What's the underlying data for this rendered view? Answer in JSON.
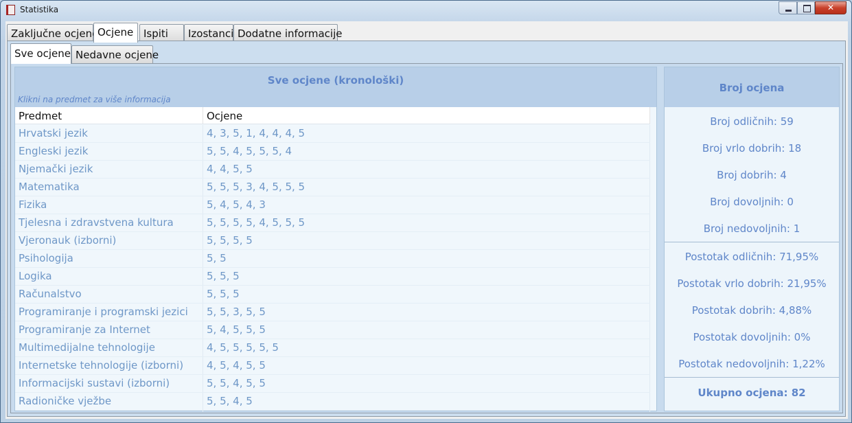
{
  "window": {
    "title": "Statistika",
    "controls": {
      "minimize": "minimize-icon",
      "maximize": "maximize-icon",
      "close": "close-icon"
    }
  },
  "main_tabs": [
    "Zaključne ocjene",
    "Ocjene",
    "Ispiti",
    "Izostanci",
    "Dodatne informacije"
  ],
  "main_tab_active": "Ocjene",
  "sub_tabs": [
    "Sve ocjene",
    "Nedavne ocjene"
  ],
  "sub_tab_active": "Sve ocjene",
  "grades_panel": {
    "title": "Sve ocjene (kronološki)",
    "hint": "Klikni na predmet za više informacija",
    "columns": [
      "Predmet",
      "Ocjene"
    ],
    "rows": [
      {
        "subject": "Hrvatski jezik",
        "grades": "4, 3, 5, 1, 4, 4, 4, 5"
      },
      {
        "subject": "Engleski jezik",
        "grades": "5, 5, 4, 5, 5, 5, 4"
      },
      {
        "subject": "Njemački jezik",
        "grades": "4, 4, 5, 5"
      },
      {
        "subject": "Matematika",
        "grades": "5, 5, 5, 3, 4, 5, 5, 5"
      },
      {
        "subject": "Fizika",
        "grades": "5, 4, 5, 4, 3"
      },
      {
        "subject": "Tjelesna i zdravstvena kultura",
        "grades": "5, 5, 5, 5, 4, 5, 5, 5"
      },
      {
        "subject": "Vjeronauk (izborni)",
        "grades": "5, 5, 5, 5"
      },
      {
        "subject": "Psihologija",
        "grades": "5, 5"
      },
      {
        "subject": "Logika",
        "grades": "5, 5, 5"
      },
      {
        "subject": "Računalstvo",
        "grades": "5, 5, 5"
      },
      {
        "subject": "Programiranje i programski jezici",
        "grades": "5, 5, 3, 5, 5"
      },
      {
        "subject": "Programiranje za Internet",
        "grades": "5, 4, 5, 5, 5"
      },
      {
        "subject": "Multimedijalne tehnologije",
        "grades": "4, 5, 5, 5, 5, 5"
      },
      {
        "subject": "Internetske tehnologije (izborni)",
        "grades": "4, 5, 4, 5, 5"
      },
      {
        "subject": "Informacijski sustavi (izborni)",
        "grades": "5, 5, 4, 5, 5"
      },
      {
        "subject": "Radioničke vježbe",
        "grades": "5, 5, 4, 5"
      }
    ]
  },
  "stats_panel": {
    "title": "Broj ocjena",
    "counts": [
      "Broj odličnih: 59",
      "Broj vrlo dobrih: 18",
      "Broj dobrih: 4",
      "Broj dovoljnih: 0",
      "Broj nedovoljnih: 1"
    ],
    "percentages": [
      "Postotak odličnih: 71,95%",
      "Postotak vrlo dobrih: 21,95%",
      "Postotak dobrih: 4,88%",
      "Postotak dovoljnih: 0%",
      "Postotak nedovoljnih: 1,22%"
    ],
    "total": "Ukupno ocjena: 82"
  },
  "colors": {
    "accent_text": "#5f86c9",
    "row_text": "#6e97c7",
    "header_bg": "#b8cfe8"
  }
}
